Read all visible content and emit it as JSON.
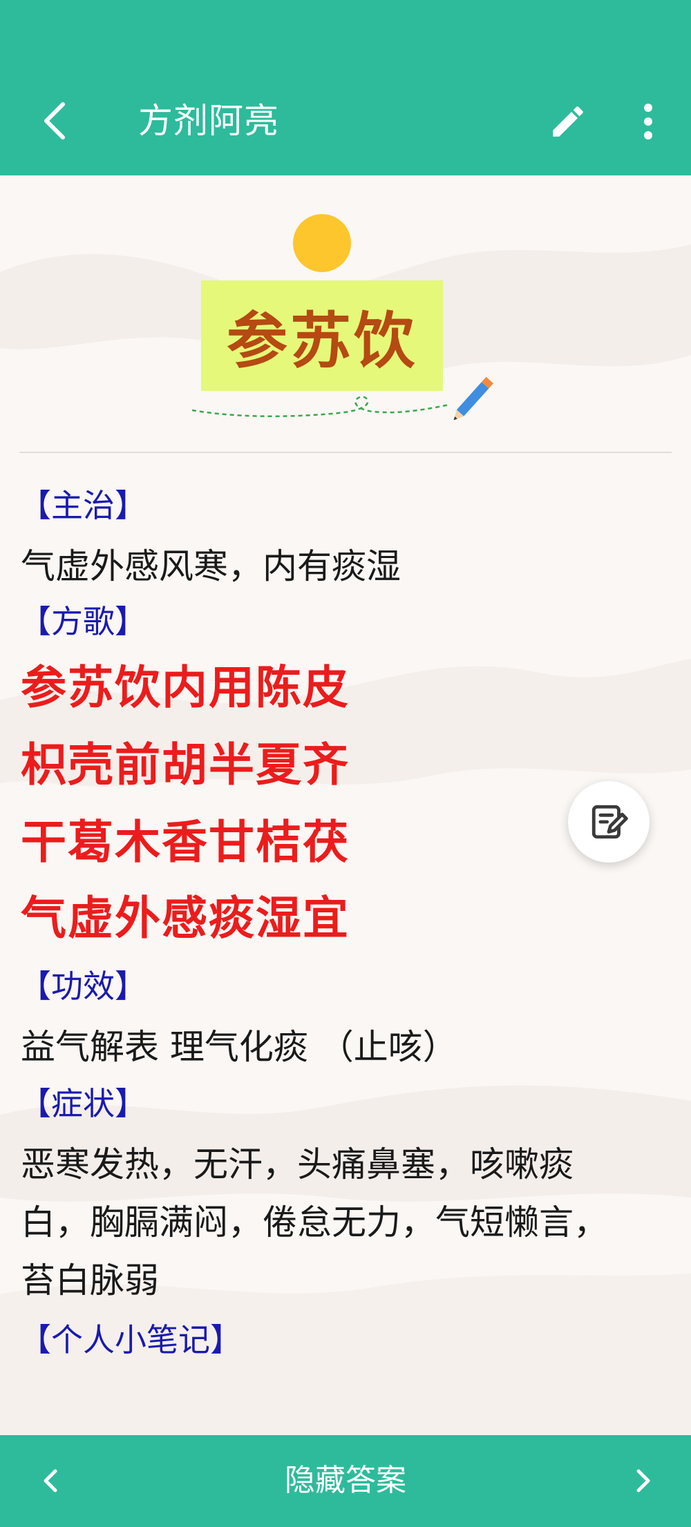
{
  "app": {
    "title": "方剂阿亮",
    "back_icon": "chevron-left-icon",
    "edit_icon": "pencil-icon",
    "more_icon": "more-vertical-icon",
    "accent_color": "#2dbb9c"
  },
  "card": {
    "formula_name": "参苏饮",
    "sections": {
      "indication": {
        "label": "【主治】",
        "text": "气虚外感风寒，内有痰湿"
      },
      "song": {
        "label": "【方歌】",
        "lines": [
          "参苏饮内用陈皮",
          "枳壳前胡半夏齐",
          "干葛木香甘桔茯",
          "气虚外感痰湿宜"
        ]
      },
      "effect": {
        "label": "【功效】",
        "text": "益气解表 理气化痰 （止咳）"
      },
      "symptoms": {
        "label": "【症状】",
        "lines": [
          "恶寒发热，无汗，头痛鼻塞，咳嗽痰",
          "白，胸膈满闷，倦怠无力，气短懒言，",
          "苔白脉弱"
        ]
      },
      "notes": {
        "label": "【个人小笔记】"
      }
    },
    "note_fab_icon": "edit-note-icon"
  },
  "bottom": {
    "prev_icon": "chevron-left-icon",
    "hide_answer": "隐藏答案",
    "next_icon": "chevron-right-icon"
  }
}
